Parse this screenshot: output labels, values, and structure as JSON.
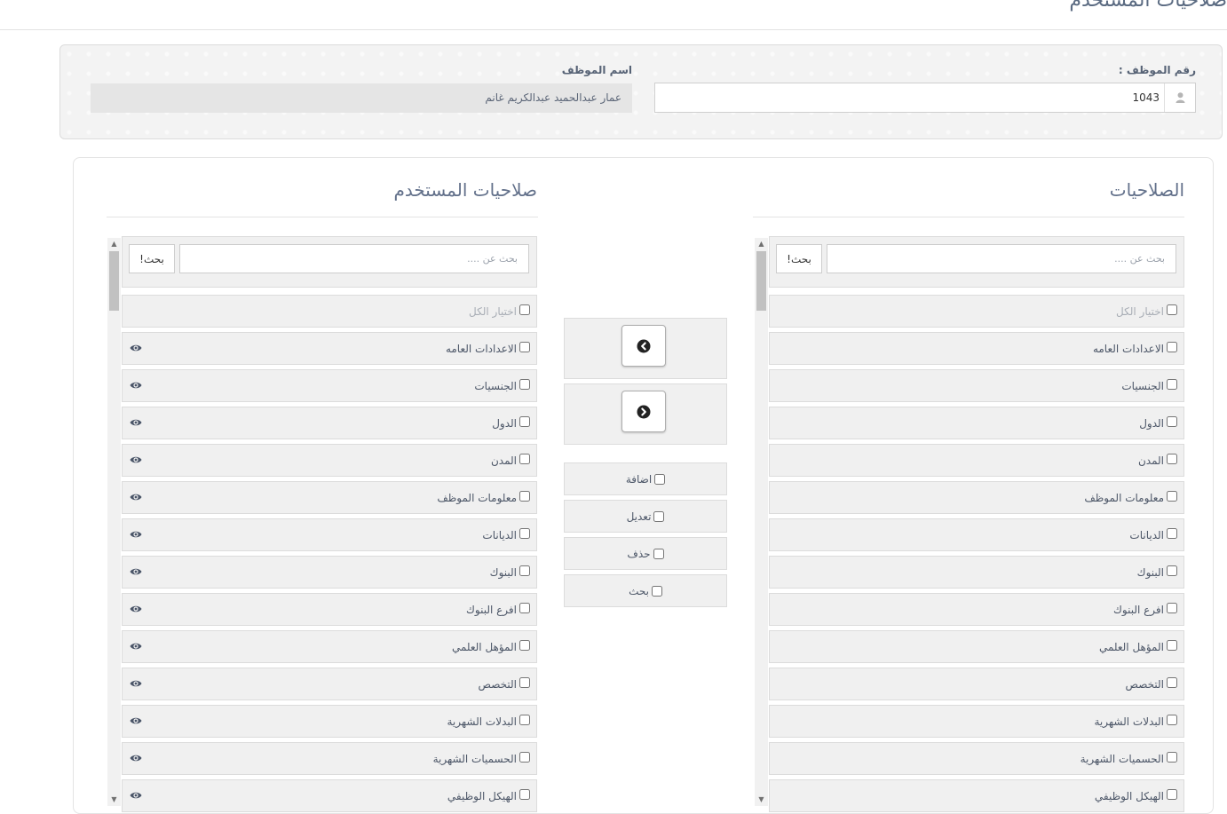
{
  "page": {
    "title": "صلاحيات المستخدم"
  },
  "employee": {
    "number_label": "رقم الموظف :",
    "number_value": "1043",
    "name_label": "اسم الموظف",
    "name_value": "عمار عبدالحميد عبدالكريم غانم"
  },
  "available": {
    "title": "الصلاحيات",
    "search_placeholder": "بحث عن ....",
    "search_button": "بحث!",
    "select_all": "اختيار الكل",
    "items": [
      "الاعدادات العامه",
      "الجنسيات",
      "الدول",
      "المدن",
      "معلومات الموظف",
      "الديانات",
      "البنوك",
      "افرع البنوك",
      "المؤهل العلمي",
      "التخصص",
      "البدلات الشهرية",
      "الحسميات الشهرية",
      "الهيكل الوظيفي"
    ]
  },
  "assigned": {
    "title": "صلاحيات المستخدم",
    "search_placeholder": "بحث عن ....",
    "search_button": "بحث!",
    "select_all": "اختيار الكل",
    "items": [
      "الاعدادات العامه",
      "الجنسيات",
      "الدول",
      "المدن",
      "معلومات الموظف",
      "الديانات",
      "البنوك",
      "افرع البنوك",
      "المؤهل العلمي",
      "التخصص",
      "البدلات الشهرية",
      "الحسميات الشهرية",
      "الهيكل الوظيفي"
    ]
  },
  "transfer": {
    "move_left_icon": "chevron-left-circle-icon",
    "move_right_icon": "chevron-right-circle-icon"
  },
  "operations": {
    "add": "اضافة",
    "edit": "تعديل",
    "delete": "حذف",
    "search": "بحث"
  },
  "icons": {
    "user": "user-icon",
    "eye": "eye-icon",
    "scroll_up": "▲",
    "scroll_down": "▼"
  }
}
